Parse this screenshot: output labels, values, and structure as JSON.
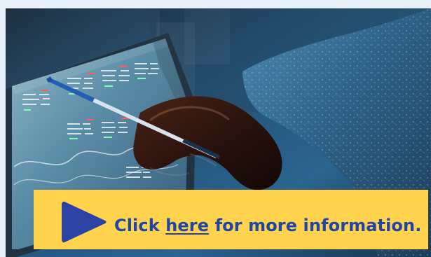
{
  "promo": {
    "text_before": "Click ",
    "link_text": "here",
    "text_after": " for more information.",
    "accent_color": "#ffd34d",
    "text_color": "#1f46a6",
    "icon": "play-icon"
  }
}
